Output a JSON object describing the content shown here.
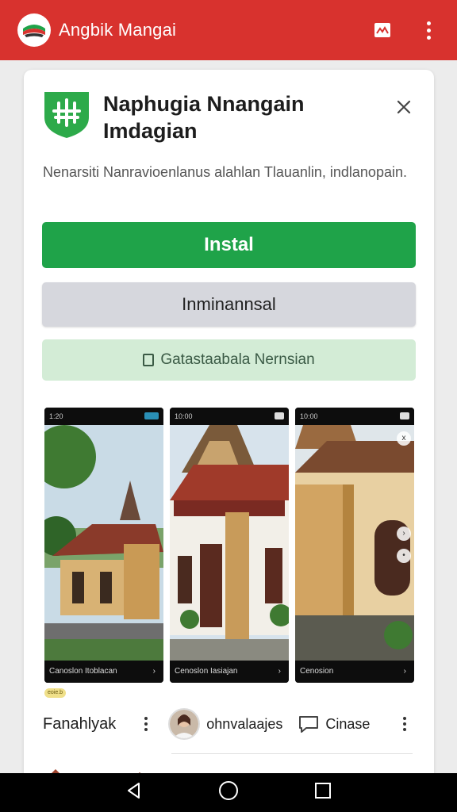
{
  "app_bar": {
    "title": "Angbik Mangai",
    "brand_color": "#d8322e",
    "actions": [
      "image-icon",
      "more-vert-icon"
    ]
  },
  "dialog": {
    "app_name": "Naphugia Nnangain Imdagian",
    "close_icon": "close-icon",
    "description": "Nenarsiti Nanravioenlanus alahlan Tlauanlin, indlanopain.",
    "install_label": "Instal",
    "uninstall_label": "Inminannsal",
    "version_label": "Gatastaabala Nernsian",
    "install_color": "#1fa349",
    "version_color": "#d3ecd6"
  },
  "screenshots": [
    {
      "status_left": "1:20",
      "bottom_label": "Canoslon   Itoblacan",
      "bottom_icon": "chevron-icon"
    },
    {
      "status_left": "10:00",
      "bottom_label": "Cenoslon   Iasiajan",
      "bottom_icon": "chevron-icon"
    },
    {
      "status_left": "10:00",
      "bottom_label": "Cenosion",
      "bottom_icon": "chevron-icon"
    }
  ],
  "chip_label": "eoie.b",
  "bottom_row": {
    "left_label": "Fanahlyak",
    "middle_label": "ohnvalaajes",
    "right_label": "Cinase",
    "right_icon": "comment-icon"
  },
  "system_nav": [
    "back-icon",
    "home-icon",
    "recents-icon"
  ]
}
